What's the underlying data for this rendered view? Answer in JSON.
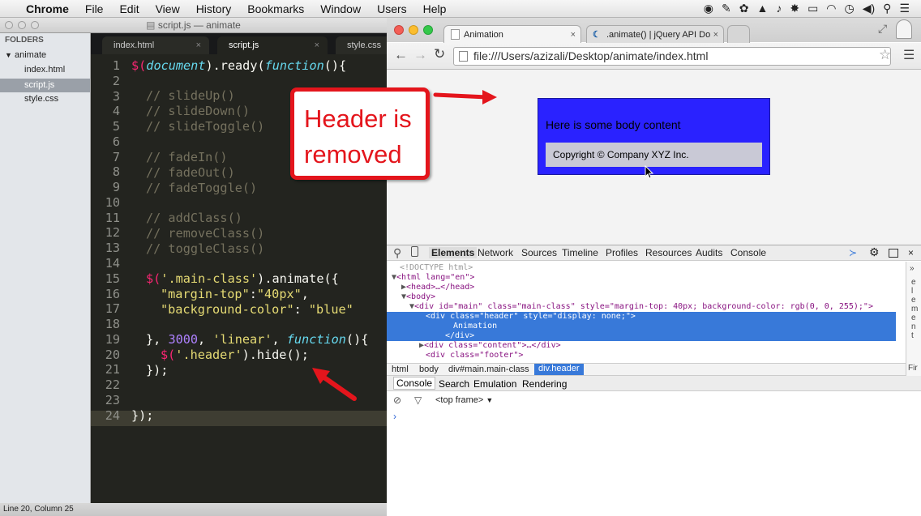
{
  "menubar": {
    "app": "Chrome",
    "items": [
      "File",
      "Edit",
      "View",
      "History",
      "Bookmarks",
      "Window",
      "Users",
      "Help"
    ]
  },
  "sublime": {
    "title": "script.js — animate",
    "sidebar": {
      "header": "FOLDERS",
      "folder": "animate",
      "files": [
        "index.html",
        "script.js",
        "style.css"
      ],
      "selected": "script.js"
    },
    "tabs": [
      {
        "label": "index.html",
        "close": "×"
      },
      {
        "label": "script.js",
        "close": "×"
      },
      {
        "label": "style.css",
        "close": ""
      }
    ],
    "status": "Line 20, Column 25",
    "line_numbers": [
      "1",
      "2",
      "3",
      "4",
      "5",
      "6",
      "7",
      "8",
      "9",
      "10",
      "11",
      "12",
      "13",
      "14",
      "15",
      "16",
      "17",
      "18",
      "19",
      "20",
      "21",
      "22",
      "23",
      "24"
    ],
    "code": {
      "l1": [
        "$(",
        "document",
        ").ready(",
        "function",
        "(){"
      ],
      "l3": "// slideUp()",
      "l4": "// slideDown()",
      "l5": "// slideToggle()",
      "l7": "// fadeIn()",
      "l8": "// fadeOut()",
      "l9": "// fadeToggle()",
      "l11": "// addClass()",
      "l12": "// removeClass()",
      "l13": "// toggleClass()",
      "l15": [
        "$(",
        "'.main-class'",
        ").animate({"
      ],
      "l16": [
        "\"margin-top\"",
        ":",
        "\"40px\"",
        ","
      ],
      "l17": [
        "\"background-color\"",
        ": ",
        "\"blue\""
      ],
      "l19": [
        "}, ",
        "3000",
        ", ",
        "'linear'",
        ", ",
        "function",
        "(){"
      ],
      "l20": [
        "$(",
        "'.header'",
        ").hide();"
      ],
      "l21": "});",
      "l24": "});"
    }
  },
  "chrome": {
    "tabs": [
      {
        "label": "Animation",
        "close": "×"
      },
      {
        "label": ".animate() | jQuery API Do",
        "close": "×"
      }
    ],
    "url": "file:///Users/azizali/Desktop/animate/index.html",
    "page": {
      "body_text": "Here is some body content",
      "footer_text": "Copyright © Company XYZ Inc.",
      "main_bg": "#2a22ff"
    },
    "devtools": {
      "tabs": [
        "Elements",
        "Network",
        "Sources",
        "Timeline",
        "Profiles",
        "Resources",
        "Audits",
        "Console"
      ],
      "dom": {
        "doctype": "<!DOCTYPE html>",
        "html_open": "<html lang=\"en\">",
        "head": "<head>…</head>",
        "body_open": "<body>",
        "main_div": "<div id=\"main\" class=\"main-class\" style=\"margin-top: 40px; background-color: rgb(0, 0, 255);\">",
        "header_div": "<div class=\"header\" style=\"display: none;\">",
        "header_text": "Animation",
        "header_close": "</div>",
        "content_div": "<div class=\"content\">…</div>",
        "footer_div": "<div class=\"footer\">"
      },
      "breadcrumbs": [
        "html",
        "body",
        "div#main.main-class",
        "div.header"
      ],
      "drawer_tabs": [
        "Console",
        "Search",
        "Emulation",
        "Rendering"
      ],
      "frame": "<top frame>",
      "right_pane": "eleme nt",
      "right_more": "Fir"
    }
  },
  "callout": {
    "line1": "Header is",
    "line2": "removed",
    "color": "#e4151c"
  }
}
